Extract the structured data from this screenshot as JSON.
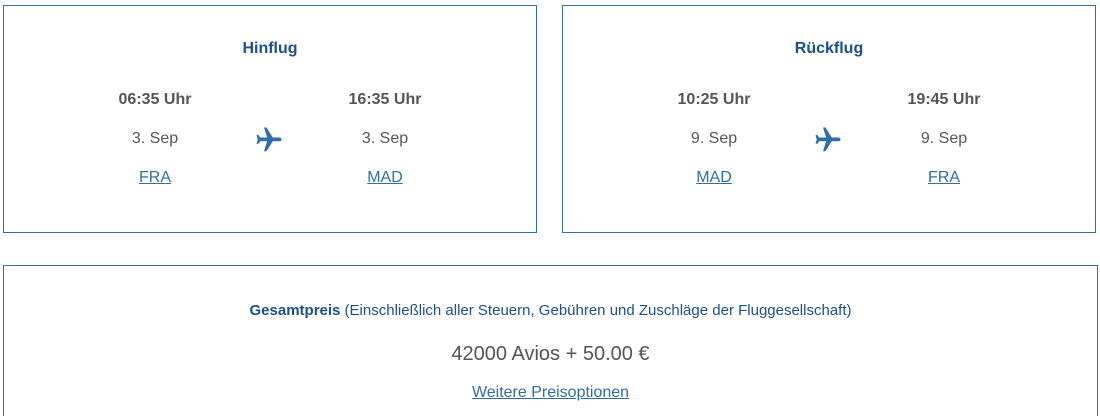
{
  "outbound": {
    "title": "Hinflug",
    "departure": {
      "time": "06:35 Uhr",
      "date": "3. Sep",
      "airport": "FRA"
    },
    "arrival": {
      "time": "16:35 Uhr",
      "date": "3. Sep",
      "airport": "MAD"
    },
    "icon": "airplane-icon"
  },
  "return": {
    "title": "Rückflug",
    "departure": {
      "time": "10:25 Uhr",
      "date": "9. Sep",
      "airport": "MAD"
    },
    "arrival": {
      "time": "19:45 Uhr",
      "date": "9. Sep",
      "airport": "FRA"
    },
    "icon": "airplane-icon"
  },
  "price": {
    "label": "Gesamtpreis",
    "note": " (Einschließlich aller Steuern, Gebühren und Zuschläge der Fluggesellschaft)",
    "value": "42000 Avios + 50.00 €",
    "more_options_link": "Weitere Preisoptionen"
  },
  "colors": {
    "border": "#2f6ea9",
    "title": "#1b4f8f",
    "text": "#555555",
    "link": "#2f6ea9"
  }
}
